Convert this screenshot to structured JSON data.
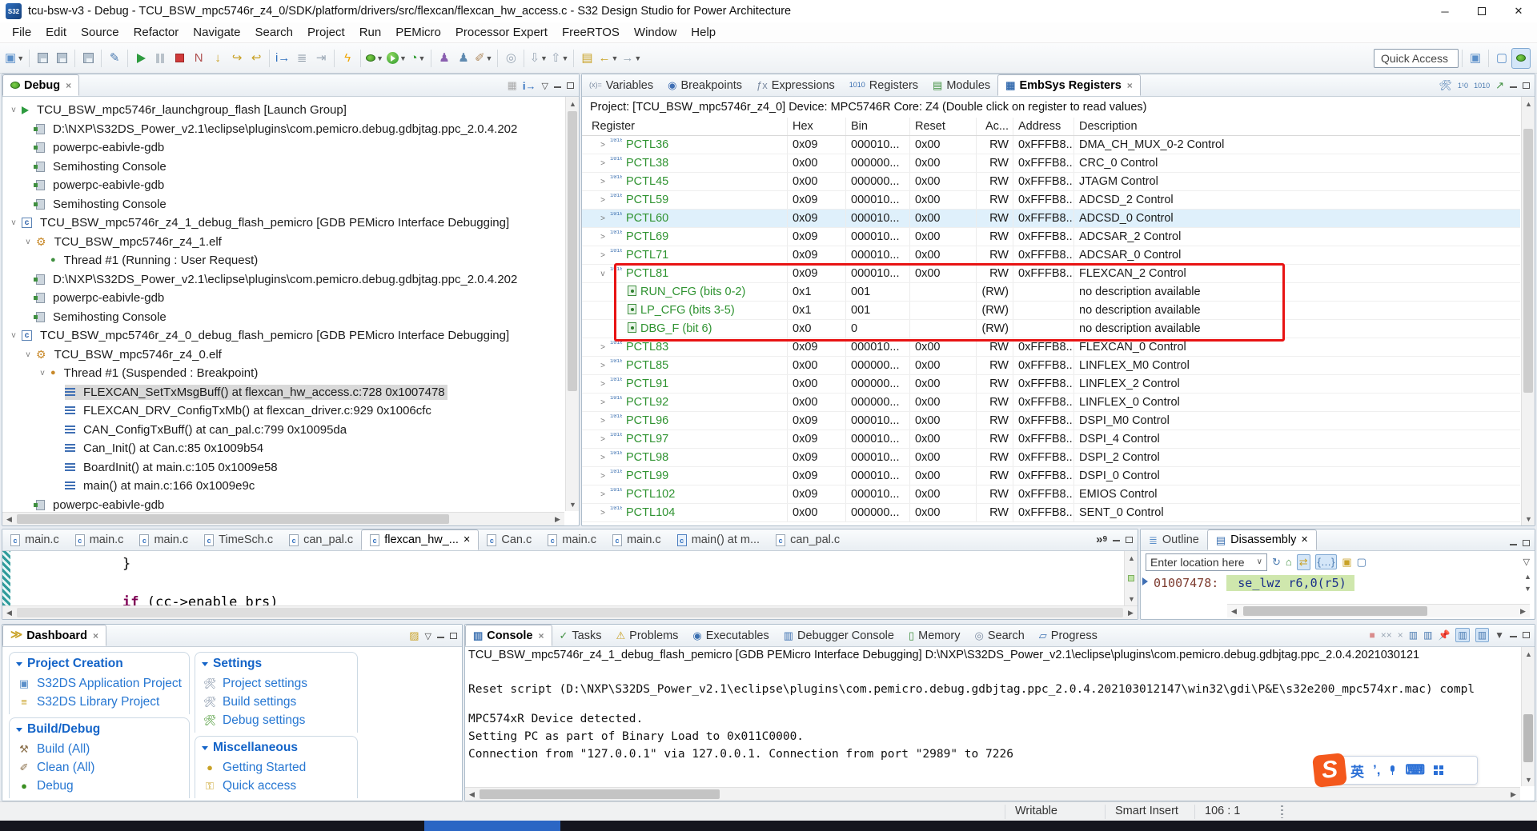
{
  "window": {
    "title": "tcu-bsw-v3 - Debug - TCU_BSW_mpc5746r_z4_0/SDK/platform/drivers/src/flexcan/flexcan_hw_access.c - S32 Design Studio for Power Architecture",
    "app_icon_text": "S32",
    "controls": {
      "minimize": "─",
      "restore": "",
      "close": "✕"
    }
  },
  "menu": {
    "items": [
      "File",
      "Edit",
      "Source",
      "Refactor",
      "Navigate",
      "Search",
      "Project",
      "Run",
      "PEMicro",
      "Processor Expert",
      "FreeRTOS",
      "Window",
      "Help"
    ]
  },
  "toolbar": {
    "quick_access_label": "Quick Access",
    "items": [
      {
        "name": "new-wizard",
        "glyph": "▣",
        "color": "#5b8fc9",
        "dropdown": true
      },
      {
        "sep": true
      },
      {
        "name": "save",
        "cls": "ic-floppy"
      },
      {
        "name": "save-all",
        "cls": "ic-floppy"
      },
      {
        "sep": true
      },
      {
        "name": "save-binary",
        "cls": "ic-floppy"
      },
      {
        "sep": true
      },
      {
        "name": "pin-editor",
        "glyph": "✎",
        "color": "#4a7ab0"
      },
      {
        "sep": true
      },
      {
        "name": "resume",
        "cls": "ic-play"
      },
      {
        "name": "suspend",
        "cls": "ic-pause"
      },
      {
        "name": "terminate",
        "cls": "ic-stop"
      },
      {
        "name": "disconnect",
        "glyph": "N",
        "color": "#b05050"
      },
      {
        "name": "step-into",
        "glyph": "↓",
        "color": "#c9a227"
      },
      {
        "name": "step-over",
        "glyph": "↪",
        "color": "#c9a227"
      },
      {
        "name": "step-return",
        "glyph": "↩",
        "color": "#c9a227"
      },
      {
        "sep": true
      },
      {
        "name": "run-to-line",
        "glyph": "i→",
        "color": "#2f6fbe"
      },
      {
        "name": "use-step-filters",
        "glyph": "≣",
        "color": "#8a97a5"
      },
      {
        "name": "skip-breakpoints",
        "glyph": "⇥",
        "color": "#9aa7b5"
      },
      {
        "sep": true
      },
      {
        "name": "flash-programmer",
        "glyph": "ϟ",
        "color": "#f0a500"
      },
      {
        "sep": true
      },
      {
        "name": "debug",
        "cls": "ic-bug",
        "dropdown": true
      },
      {
        "name": "run",
        "cls": "ic-circle-run",
        "dropdown": true
      },
      {
        "name": "profile",
        "glyph": "◔",
        "color": "#2f9b2f",
        "dropdown": true
      },
      {
        "sep": true
      },
      {
        "name": "new-cpp-class",
        "glyph": "♟",
        "color": "#8a5fb0"
      },
      {
        "name": "new-cpp-project",
        "glyph": "♟",
        "color": "#5f8ab0"
      },
      {
        "name": "format-brush",
        "glyph": "✐",
        "color": "#b08a5f",
        "dropdown": true
      },
      {
        "sep": true
      },
      {
        "name": "search",
        "glyph": "◎",
        "color": "#9aa7b5"
      },
      {
        "sep": true
      },
      {
        "name": "last-edit-location",
        "glyph": "⇩",
        "color": "#9aa7b5",
        "dropdown": true
      },
      {
        "name": "next-annotation",
        "glyph": "⇧",
        "color": "#9aa7b5",
        "dropdown": true
      },
      {
        "sep": true
      },
      {
        "name": "open-element",
        "glyph": "▤",
        "color": "#c9a227"
      },
      {
        "name": "back",
        "glyph": "←",
        "color": "#c9a227",
        "dropdown": true
      },
      {
        "name": "forward",
        "glyph": "→",
        "color": "#9aa7b5",
        "dropdown": true
      }
    ],
    "right_items": [
      {
        "name": "open-perspective",
        "glyph": "▣",
        "color": "#5b8fc9"
      },
      {
        "sep": true
      },
      {
        "name": "cpp-perspective",
        "glyph": "▢",
        "color": "#5b8fc9"
      },
      {
        "name": "debug-perspective",
        "cls": "ic-bug",
        "active": true
      }
    ]
  },
  "debug_panel": {
    "tab": "Debug",
    "toolbar_icons": [
      "remove-all-terminated",
      "focus-process",
      "view-menu",
      "minimize",
      "maximize"
    ],
    "tree": [
      {
        "indent": 0,
        "chevron": "v",
        "icon": "launch-group",
        "label": "TCU_BSW_mpc5746r_launchgroup_flash [Launch Group]"
      },
      {
        "indent": 1,
        "icon": "process",
        "label": "D:\\NXP\\S32DS_Power_v2.1\\eclipse\\plugins\\com.pemicro.debug.gdbjtag.ppc_2.0.4.202"
      },
      {
        "indent": 1,
        "icon": "process",
        "label": "powerpc-eabivle-gdb"
      },
      {
        "indent": 1,
        "icon": "process",
        "label": "Semihosting Console"
      },
      {
        "indent": 1,
        "icon": "process",
        "label": "powerpc-eabivle-gdb"
      },
      {
        "indent": 1,
        "icon": "process",
        "label": "Semihosting Console"
      },
      {
        "indent": 0,
        "chevron": "v",
        "icon": "c-app",
        "label": "TCU_BSW_mpc5746r_z4_1_debug_flash_pemicro [GDB PEMicro Interface Debugging]"
      },
      {
        "indent": 1,
        "chevron": "v",
        "icon": "elf",
        "label": "TCU_BSW_mpc5746r_z4_1.elf"
      },
      {
        "indent": 2,
        "icon": "thread-running",
        "label": "Thread #1 (Running : User Request)"
      },
      {
        "indent": 1,
        "icon": "process",
        "label": "D:\\NXP\\S32DS_Power_v2.1\\eclipse\\plugins\\com.pemicro.debug.gdbjtag.ppc_2.0.4.202"
      },
      {
        "indent": 1,
        "icon": "process",
        "label": "powerpc-eabivle-gdb"
      },
      {
        "indent": 1,
        "icon": "process",
        "label": "Semihosting Console"
      },
      {
        "indent": 0,
        "chevron": "v",
        "icon": "c-app",
        "label": "TCU_BSW_mpc5746r_z4_0_debug_flash_pemicro [GDB PEMicro Interface Debugging]"
      },
      {
        "indent": 1,
        "chevron": "v",
        "icon": "elf",
        "label": "TCU_BSW_mpc5746r_z4_0.elf"
      },
      {
        "indent": 2,
        "chevron": "v",
        "icon": "thread-suspended",
        "label": "Thread #1 (Suspended : Breakpoint)"
      },
      {
        "indent": 3,
        "icon": "stack-frame",
        "label": "FLEXCAN_SetTxMsgBuff() at flexcan_hw_access.c:728 0x1007478",
        "selected": true
      },
      {
        "indent": 3,
        "icon": "stack-frame",
        "label": "FLEXCAN_DRV_ConfigTxMb() at flexcan_driver.c:929 0x1006cfc"
      },
      {
        "indent": 3,
        "icon": "stack-frame",
        "label": "CAN_ConfigTxBuff() at can_pal.c:799 0x10095da"
      },
      {
        "indent": 3,
        "icon": "stack-frame",
        "label": "Can_Init() at Can.c:85 0x1009b54"
      },
      {
        "indent": 3,
        "icon": "stack-frame",
        "label": "BoardInit() at main.c:105 0x1009e58"
      },
      {
        "indent": 3,
        "icon": "stack-frame",
        "label": "main() at main.c:166 0x1009e9c"
      },
      {
        "indent": 1,
        "icon": "process",
        "label": "powerpc-eabivle-gdb"
      }
    ]
  },
  "registers_panel": {
    "tabs": [
      {
        "label": "Variables",
        "icon": "variables"
      },
      {
        "label": "Breakpoints",
        "icon": "breakpoints"
      },
      {
        "label": "Expressions",
        "icon": "expressions"
      },
      {
        "label": "Registers",
        "icon": "registers"
      },
      {
        "label": "Modules",
        "icon": "modules"
      },
      {
        "label": "EmbSys Registers",
        "icon": "embsys",
        "active": true,
        "closable": true
      }
    ],
    "toolbar_icons": [
      "tools",
      "binary-edit",
      "binary",
      "export",
      "minimize",
      "maximize"
    ],
    "subtitle_left": "Project: [TCU_BSW_mpc5746r_z4_0] Device: MPC5746R Core: Z4",
    "subtitle_right": "(Double click on register to read values)",
    "columns": [
      "Register",
      "Hex",
      "Bin",
      "Reset",
      "Ac...",
      "Address",
      "Description"
    ],
    "rows": [
      {
        "name": "PCTL36",
        "hex": "0x09",
        "bin": "000010...",
        "reset": "0x00",
        "access": "RW",
        "address": "0xFFFB8...",
        "desc": "DMA_CH_MUX_0-2 Control"
      },
      {
        "name": "PCTL38",
        "hex": "0x00",
        "bin": "000000...",
        "reset": "0x00",
        "access": "RW",
        "address": "0xFFFB8...",
        "desc": "CRC_0 Control"
      },
      {
        "name": "PCTL45",
        "hex": "0x00",
        "bin": "000000...",
        "reset": "0x00",
        "access": "RW",
        "address": "0xFFFB8...",
        "desc": "JTAGM Control"
      },
      {
        "name": "PCTL59",
        "hex": "0x09",
        "bin": "000010...",
        "reset": "0x00",
        "access": "RW",
        "address": "0xFFFB8...",
        "desc": "ADCSD_2 Control"
      },
      {
        "name": "PCTL60",
        "hex": "0x09",
        "bin": "000010...",
        "reset": "0x00",
        "access": "RW",
        "address": "0xFFFB8...",
        "desc": "ADCSD_0 Control",
        "highlight": true
      },
      {
        "name": "PCTL69",
        "hex": "0x09",
        "bin": "000010...",
        "reset": "0x00",
        "access": "RW",
        "address": "0xFFFB8...",
        "desc": "ADCSAR_2 Control"
      },
      {
        "name": "PCTL71",
        "hex": "0x09",
        "bin": "000010...",
        "reset": "0x00",
        "access": "RW",
        "address": "0xFFFB8...",
        "desc": "ADCSAR_0 Control"
      },
      {
        "name": "PCTL81",
        "hex": "0x09",
        "bin": "000010...",
        "reset": "0x00",
        "access": "RW",
        "address": "0xFFFB8...",
        "desc": "FLEXCAN_2 Control",
        "expanded": true
      },
      {
        "name": "RUN_CFG (bits 0-2)",
        "field": true,
        "hex": "0x1",
        "bin": "001",
        "reset": "",
        "access": "(RW)",
        "address": "",
        "desc": "no description available"
      },
      {
        "name": "LP_CFG (bits 3-5)",
        "field": true,
        "hex": "0x1",
        "bin": "001",
        "reset": "",
        "access": "(RW)",
        "address": "",
        "desc": "no description available"
      },
      {
        "name": "DBG_F (bit 6)",
        "field": true,
        "hex": "0x0",
        "bin": "0",
        "reset": "",
        "access": "(RW)",
        "address": "",
        "desc": "no description available"
      },
      {
        "name": "PCTL83",
        "hex": "0x09",
        "bin": "000010...",
        "reset": "0x00",
        "access": "RW",
        "address": "0xFFFB8...",
        "desc": "FLEXCAN_0 Control"
      },
      {
        "name": "PCTL85",
        "hex": "0x00",
        "bin": "000000...",
        "reset": "0x00",
        "access": "RW",
        "address": "0xFFFB8...",
        "desc": "LINFLEX_M0 Control"
      },
      {
        "name": "PCTL91",
        "hex": "0x00",
        "bin": "000000...",
        "reset": "0x00",
        "access": "RW",
        "address": "0xFFFB8...",
        "desc": "LINFLEX_2 Control"
      },
      {
        "name": "PCTL92",
        "hex": "0x00",
        "bin": "000000...",
        "reset": "0x00",
        "access": "RW",
        "address": "0xFFFB8...",
        "desc": "LINFLEX_0 Control"
      },
      {
        "name": "PCTL96",
        "hex": "0x09",
        "bin": "000010...",
        "reset": "0x00",
        "access": "RW",
        "address": "0xFFFB8...",
        "desc": "DSPI_M0 Control"
      },
      {
        "name": "PCTL97",
        "hex": "0x09",
        "bin": "000010...",
        "reset": "0x00",
        "access": "RW",
        "address": "0xFFFB8...",
        "desc": "DSPI_4 Control"
      },
      {
        "name": "PCTL98",
        "hex": "0x09",
        "bin": "000010...",
        "reset": "0x00",
        "access": "RW",
        "address": "0xFFFB8...",
        "desc": "DSPI_2 Control"
      },
      {
        "name": "PCTL99",
        "hex": "0x09",
        "bin": "000010...",
        "reset": "0x00",
        "access": "RW",
        "address": "0xFFFB8...",
        "desc": "DSPI_0 Control"
      },
      {
        "name": "PCTL102",
        "hex": "0x09",
        "bin": "000010...",
        "reset": "0x00",
        "access": "RW",
        "address": "0xFFFB8...",
        "desc": "EMIOS Control"
      },
      {
        "name": "PCTL104",
        "hex": "0x00",
        "bin": "000000...",
        "reset": "0x00",
        "access": "RW",
        "address": "0xFFFB8...",
        "desc": "SENT_0 Control"
      }
    ]
  },
  "editor": {
    "tabs": [
      {
        "label": "main.c",
        "icon": "c-file"
      },
      {
        "label": "main.c",
        "icon": "c-file"
      },
      {
        "label": "main.c",
        "icon": "c-file"
      },
      {
        "label": "TimeSch.c",
        "icon": "c-file"
      },
      {
        "label": "can_pal.c",
        "icon": "c-file"
      },
      {
        "label": "flexcan_hw_...",
        "icon": "c-file",
        "active": true,
        "closable": true
      },
      {
        "label": "Can.c",
        "icon": "c-file"
      },
      {
        "label": "main.c",
        "icon": "c-file"
      },
      {
        "label": "main.c",
        "icon": "c-file"
      },
      {
        "label": "main() at m...",
        "icon": "c-file-frame"
      },
      {
        "label": "can_pal.c",
        "icon": "c-file"
      }
    ],
    "overflow_count": "9",
    "code": {
      "line1": "}",
      "line2_kw": "if",
      "line2_rest": " (cc->enable_brs)"
    }
  },
  "outline_panel": {
    "tabs": [
      {
        "label": "Outline",
        "icon": "outline"
      },
      {
        "label": "Disassembly",
        "icon": "disassembly",
        "active": true,
        "closable": true
      }
    ],
    "location_placeholder": "Enter location here",
    "toolbar_icons": [
      "refresh",
      "home",
      "link-arrows",
      "show-source",
      "new-view",
      "settings"
    ],
    "address": "01007478:",
    "instruction": "se_lwz   r6,0(r5)"
  },
  "dashboard": {
    "tab": "Dashboard",
    "toolbar_icons": [
      "open-folder",
      "view-menu",
      "minimize",
      "maximize"
    ],
    "sections": [
      {
        "col": 1,
        "title": "Project Creation",
        "items": [
          {
            "icon": "new-project",
            "label": "S32DS Application Project"
          },
          {
            "icon": "library-project",
            "label": "S32DS Library Project"
          }
        ]
      },
      {
        "col": 1,
        "title": "Build/Debug",
        "items": [
          {
            "icon": "hammer",
            "label": "Build   (All)"
          },
          {
            "icon": "broom",
            "label": "Clean  (All)"
          },
          {
            "icon": "bug",
            "label": "Debug"
          }
        ]
      },
      {
        "col": 2,
        "title": "Settings",
        "items": [
          {
            "icon": "wrench",
            "label": "Project settings"
          },
          {
            "icon": "wrench",
            "label": "Build settings"
          },
          {
            "icon": "wrench-bug",
            "label": "Debug settings"
          }
        ]
      },
      {
        "col": 2,
        "title": "Miscellaneous",
        "items": [
          {
            "icon": "globe",
            "label": "Getting Started"
          },
          {
            "icon": "key",
            "label": "Quick access"
          }
        ]
      }
    ]
  },
  "console_panel": {
    "tabs": [
      {
        "label": "Console",
        "icon": "console",
        "active": true,
        "closable": true
      },
      {
        "label": "Tasks",
        "icon": "tasks"
      },
      {
        "label": "Problems",
        "icon": "problems"
      },
      {
        "label": "Executables",
        "icon": "executables"
      },
      {
        "label": "Debugger Console",
        "icon": "debugger-console"
      },
      {
        "label": "Memory",
        "icon": "memory"
      },
      {
        "label": "Search",
        "icon": "search"
      },
      {
        "label": "Progress",
        "icon": "progress"
      }
    ],
    "toolbar_icons": [
      "terminate",
      "remove-all",
      "remove",
      "pin-console",
      "scroll-lock",
      "word-wrap",
      "show-stdout",
      "show-stderr",
      "open-console",
      "view-menu",
      "minimize",
      "maximize"
    ],
    "title_line": "TCU_BSW_mpc5746r_z4_1_debug_flash_pemicro [GDB PEMicro Interface Debugging] D:\\NXP\\S32DS_Power_v2.1\\eclipse\\plugins\\com.pemicro.debug.gdbjtag.ppc_2.0.4.2021030121",
    "lines": [
      "Reset script (D:\\NXP\\S32DS_Power_v2.1\\eclipse\\plugins\\com.pemicro.debug.gdbjtag.ppc_2.0.4.202103012147\\win32\\gdi\\P&E\\s32e200_mpc574xr.mac) compl",
      "MPC574xR Device detected.",
      "Setting PC as part of Binary Load to 0x011C0000.",
      "Connection from \"127.0.0.1\" via 127.0.0.1. Connection from port \"2989\" to 7226"
    ]
  },
  "ime": {
    "logo": "S",
    "lang": "英",
    "punct": "’,",
    "keyboard": "⌨"
  },
  "status_bar": {
    "writable": "Writable",
    "insert_mode": "Smart Insert",
    "position": "106 : 1"
  },
  "colors": {
    "accent_blue": "#2f6fbe",
    "register_green": "#2f9331",
    "annotation_red": "#e81313",
    "disasm_highlight": "#cfe7ad",
    "selection_grey": "#d9d9d9",
    "row_highlight": "#dff0fb",
    "ime_orange": "#f4581c"
  }
}
